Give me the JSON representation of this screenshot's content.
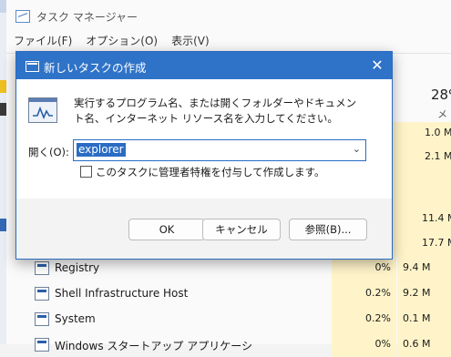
{
  "task_manager": {
    "title": "タスク マネージャー",
    "menu": [
      "ファイル(F)",
      "オプション(O)",
      "表示(V)"
    ],
    "cpu_header": "28%",
    "memory_header": "メモ",
    "partial_values": {
      "m1": "1.0 M",
      "m2": "2.1 M",
      "m3": "11.4 M",
      "m4": "17.7 M"
    },
    "processes": [
      {
        "name": "Registry",
        "cpu": "0%",
        "memory": "9.4 M"
      },
      {
        "name": "Shell Infrastructure Host",
        "cpu": "0.2%",
        "memory": "9.2 M"
      },
      {
        "name": "System",
        "cpu": "0.2%",
        "memory": "0.1 M"
      },
      {
        "name": "Windows スタートアップ アプリケーシ",
        "cpu": "0%",
        "memory": "0.6 M"
      }
    ]
  },
  "run_dialog": {
    "title": "新しいタスクの作成",
    "description": "実行するプログラム名、または開くフォルダーやドキュメント名、インターネット リソース名を入力してください。",
    "open_label": "開く(O):",
    "input_value": "explorer",
    "admin_checkbox_label": "このタスクに管理者特権を付与して作成します。",
    "admin_checked": false,
    "ok_label": "OK",
    "cancel_label": "キャンセル",
    "browse_label": "参照(B)...",
    "close_symbol": "✕",
    "dropdown_symbol": "⌄"
  }
}
